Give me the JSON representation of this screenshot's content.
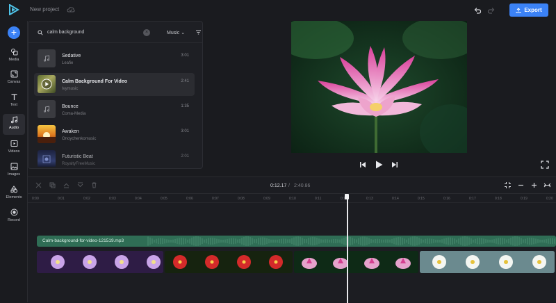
{
  "header": {
    "project_title": "New project",
    "export_label": "Export"
  },
  "sidebar": {
    "items": [
      {
        "label": "Media"
      },
      {
        "label": "Canvas"
      },
      {
        "label": "Text"
      },
      {
        "label": "Audio"
      },
      {
        "label": "Videos"
      },
      {
        "label": "Images"
      },
      {
        "label": "Elements"
      },
      {
        "label": "Record"
      }
    ]
  },
  "audio_panel": {
    "search_value": "calm background",
    "filter_label": "Music",
    "tracks": [
      {
        "title": "Sedative",
        "artist": "Leafie",
        "duration": "3:01"
      },
      {
        "title": "Calm Background For Video",
        "artist": "Ivymusic",
        "duration": "2:41"
      },
      {
        "title": "Bounce",
        "artist": "Coma-Media",
        "duration": "1:35"
      },
      {
        "title": "Awaken",
        "artist": "Onoychenkomusic",
        "duration": "3:01"
      },
      {
        "title": "Futuristic Beat",
        "artist": "RoyaltyFreeMusic",
        "duration": "2:01"
      }
    ]
  },
  "timeline": {
    "current_time": "0:12.17",
    "separator": "/",
    "total_time": "2:40.86",
    "ruler_ticks": [
      "0:00",
      "0:01",
      "0:02",
      "0:03",
      "0:04",
      "0:05",
      "0:06",
      "0:07",
      "0:08",
      "0:09",
      "0:10",
      "0:11",
      "0:12",
      "0:13",
      "0:14",
      "0:15",
      "0:16",
      "0:17",
      "0:18",
      "0:19",
      "0:20"
    ],
    "audio_clip_label": "Calm-background-for-video-121519.mp3"
  },
  "colors": {
    "accent": "#3b82f6",
    "audio_track": "#2f6d55",
    "background": "#1a1b1f"
  }
}
